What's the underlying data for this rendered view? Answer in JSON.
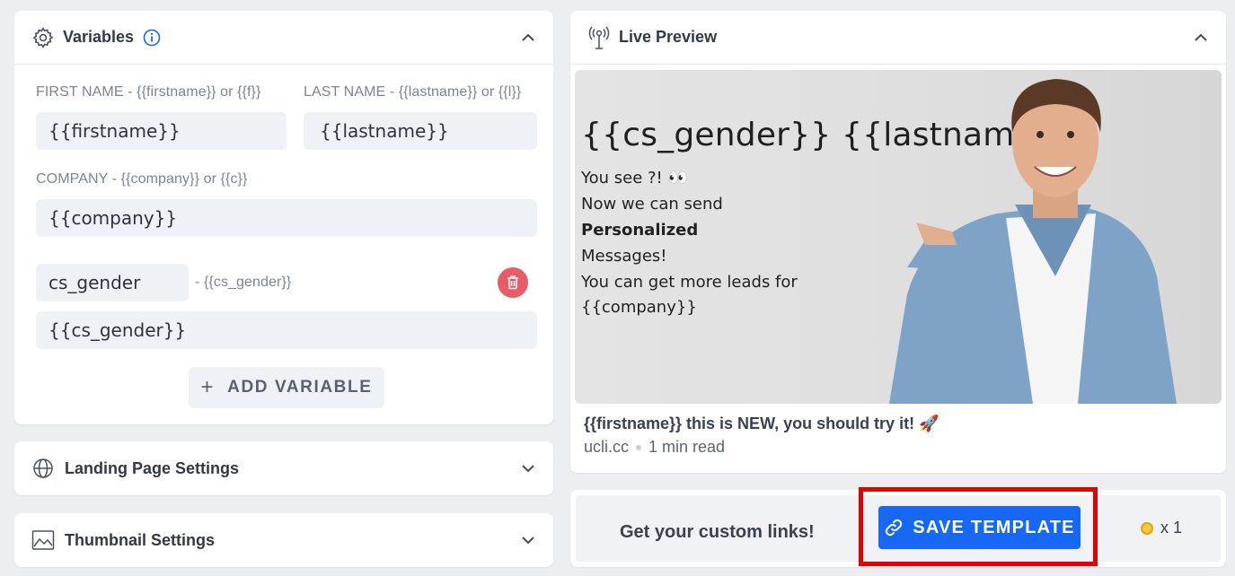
{
  "variables": {
    "title": "Variables",
    "firstname_label": "FIRST NAME - {{firstname}} or {{f}}",
    "firstname_value": "{{firstname}}",
    "lastname_label": "LAST NAME - {{lastname}} or {{l}}",
    "lastname_value": "{{lastname}}",
    "company_label": "COMPANY - {{company}} or {{c}}",
    "company_value": "{{company}}",
    "custom_name": "cs_gender",
    "custom_token": "- {{cs_gender}}",
    "custom_value": "{{cs_gender}}",
    "add_plus": "+",
    "add_label": "ADD VARIABLE"
  },
  "landing": {
    "title": "Landing Page Settings"
  },
  "thumbnail": {
    "title": "Thumbnail Settings"
  },
  "preview": {
    "title": "Live Preview",
    "headline": "{{cs_gender}} {{lastname}}",
    "lines": [
      "You see ?! 👀",
      "Now we can send",
      "Personalized",
      "Messages!",
      "You can get more leads for",
      "{{company}}"
    ],
    "link_title": "{{firstname}} this is NEW, you should try it! 🚀",
    "domain": "ucli.cc",
    "read_time": "1 min read"
  },
  "savebar": {
    "cta_text": "Get your custom links!",
    "save_label": "SAVE TEMPLATE",
    "credits": "x 1"
  },
  "colors": {
    "accent": "#1668f5",
    "delete": "#e85c67",
    "highlight": "#e30000"
  }
}
